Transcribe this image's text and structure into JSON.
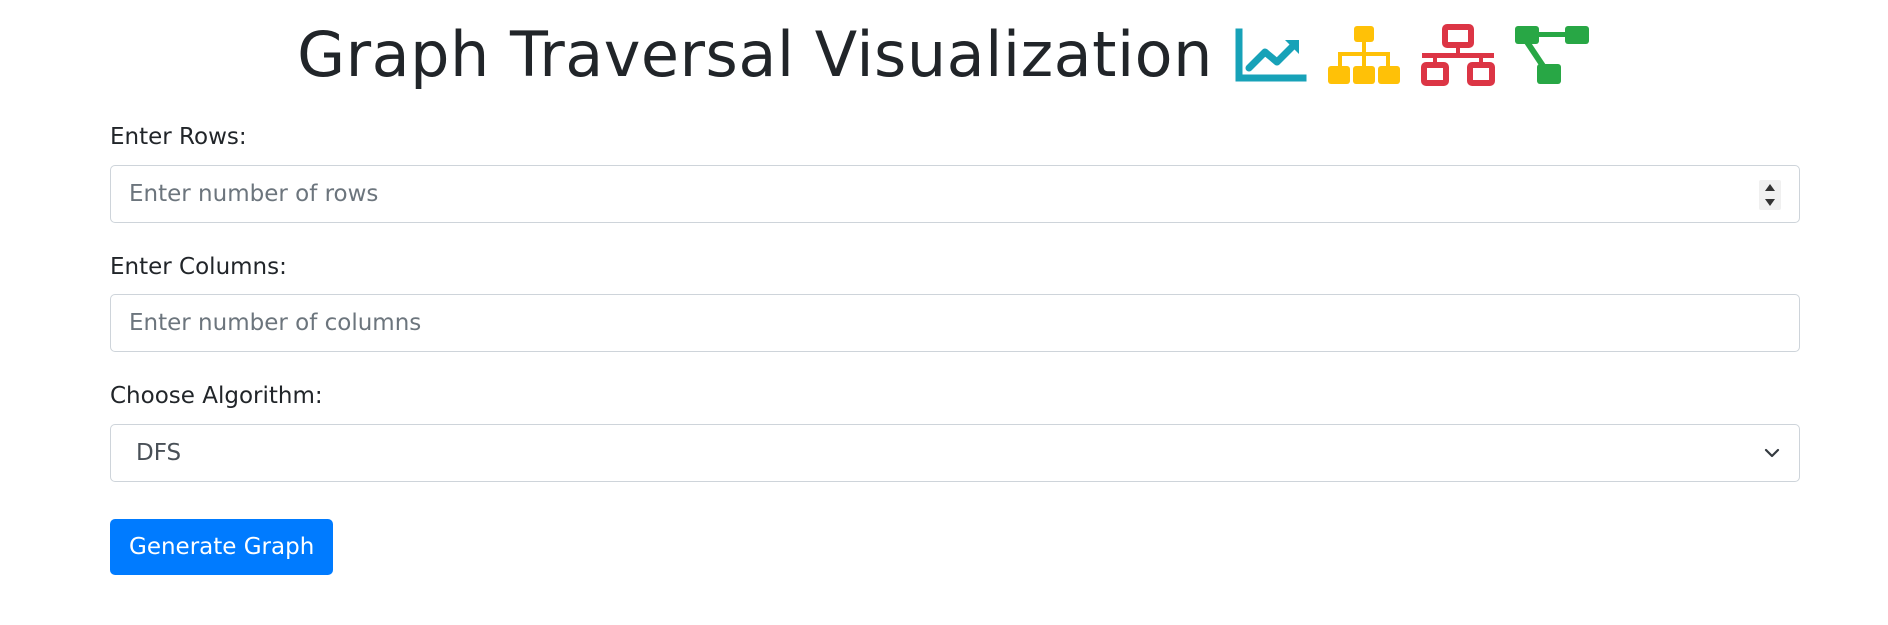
{
  "header": {
    "title": "Graph Traversal Visualization",
    "icons": [
      {
        "name": "chart-line-icon",
        "color": "#17a2b8"
      },
      {
        "name": "sitemap-icon",
        "color": "#ffc107"
      },
      {
        "name": "network-wired-icon",
        "color": "#dc3545"
      },
      {
        "name": "project-diagram-icon",
        "color": "#28a745"
      }
    ]
  },
  "form": {
    "rows": {
      "label": "Enter Rows:",
      "placeholder": "Enter number of rows",
      "value": ""
    },
    "columns": {
      "label": "Enter Columns:",
      "placeholder": "Enter number of columns",
      "value": ""
    },
    "algorithm": {
      "label": "Choose Algorithm:",
      "selected": "DFS"
    },
    "submit_label": "Generate Graph"
  },
  "colors": {
    "primary": "#007bff",
    "text": "#212529",
    "border": "#ced4da"
  }
}
